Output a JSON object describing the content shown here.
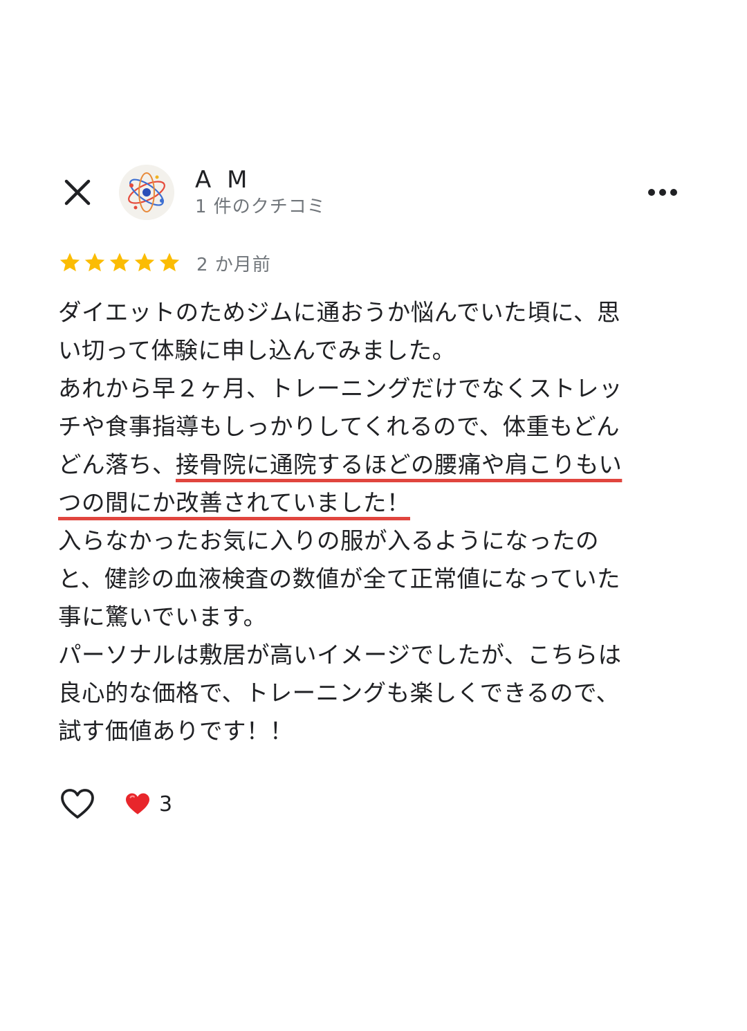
{
  "header": {
    "user_name": "A M",
    "user_sub": "1 件のクチコミ"
  },
  "review": {
    "rating": 5,
    "time": "2 か月前",
    "lines": [
      [
        {
          "text": "ダイエットのためジムに通おうか悩んでいた頃に、思",
          "hl": false
        }
      ],
      [
        {
          "text": "い切って体験に申し込んでみました。",
          "hl": false
        }
      ],
      [
        {
          "text": "あれから早２ヶ月、トレーニングだけでなくストレッ",
          "hl": false
        }
      ],
      [
        {
          "text": "チや食事指導もしっかりしてくれるので、体重もどん",
          "hl": false
        }
      ],
      [
        {
          "text": "どん落ち、",
          "hl": false
        },
        {
          "text": "接骨院に通院するほどの腰痛や肩こりもい",
          "hl": true
        }
      ],
      [
        {
          "text": "つの間にか改善されていました！",
          "hl": true
        }
      ],
      [
        {
          "text": "入らなかったお気に入りの服が入るようになったの",
          "hl": false
        }
      ],
      [
        {
          "text": "と、健診の血液検査の数値が全て正常値になっていた",
          "hl": false
        }
      ],
      [
        {
          "text": "事に驚いでいます。",
          "hl": false
        }
      ],
      [
        {
          "text": "パーソナルは敷居が高いイメージでしたが、こちらは",
          "hl": false
        }
      ],
      [
        {
          "text": "良心的な価格で、トレーニングも楽しくできるので、",
          "hl": false
        }
      ],
      [
        {
          "text": "試す価値ありです！！",
          "hl": false
        }
      ]
    ]
  },
  "footer": {
    "reaction_count": "3"
  },
  "colors": {
    "star": "#fbbc04",
    "highlight_underline": "#e0453e",
    "secondary_text": "#70757a",
    "heart_reaction": "#e8262b"
  },
  "icons": {
    "close": "close-icon",
    "more": "more-options-icon",
    "star": "star-icon",
    "like": "heart-outline-icon",
    "reaction": "red-heart-icon",
    "avatar": "atom-avatar"
  }
}
